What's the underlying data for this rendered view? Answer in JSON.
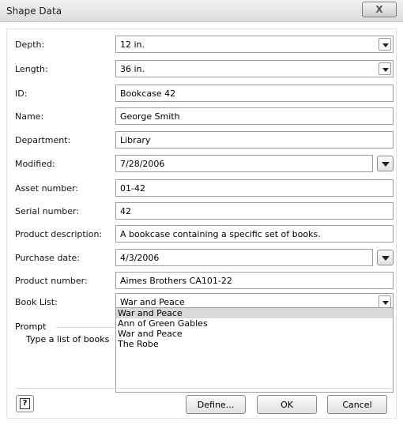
{
  "window": {
    "title": "Shape Data",
    "close_label": "X"
  },
  "fields": {
    "depth": {
      "label": "Depth:",
      "value": "12 in."
    },
    "length": {
      "label": "Length:",
      "value": "36 in."
    },
    "id": {
      "label": "ID:",
      "value": "Bookcase 42"
    },
    "name": {
      "label": "Name:",
      "value": "George Smith"
    },
    "department": {
      "label": "Department:",
      "value": "Library"
    },
    "modified": {
      "label": "Modified:",
      "value": "7/28/2006"
    },
    "asset_number": {
      "label": "Asset number:",
      "value": "01-42"
    },
    "serial_number": {
      "label": "Serial number:",
      "value": "42"
    },
    "product_description": {
      "label": "Product description:",
      "value": "A bookcase containing a specific set of books."
    },
    "purchase_date": {
      "label": "Purchase date:",
      "value": "4/3/2006"
    },
    "product_number": {
      "label": "Product number:",
      "value": "Aimes Brothers CA101-22"
    },
    "book_list": {
      "label": "Book List:",
      "value": "War and Peace",
      "options": [
        "War and Peace",
        "Ann of Green Gables",
        "War and Peace",
        "The Robe"
      ]
    }
  },
  "prompt": {
    "label": "Prompt",
    "text": "Type a list of books"
  },
  "buttons": {
    "help": "?",
    "define": "Define...",
    "ok": "OK",
    "cancel": "Cancel"
  }
}
